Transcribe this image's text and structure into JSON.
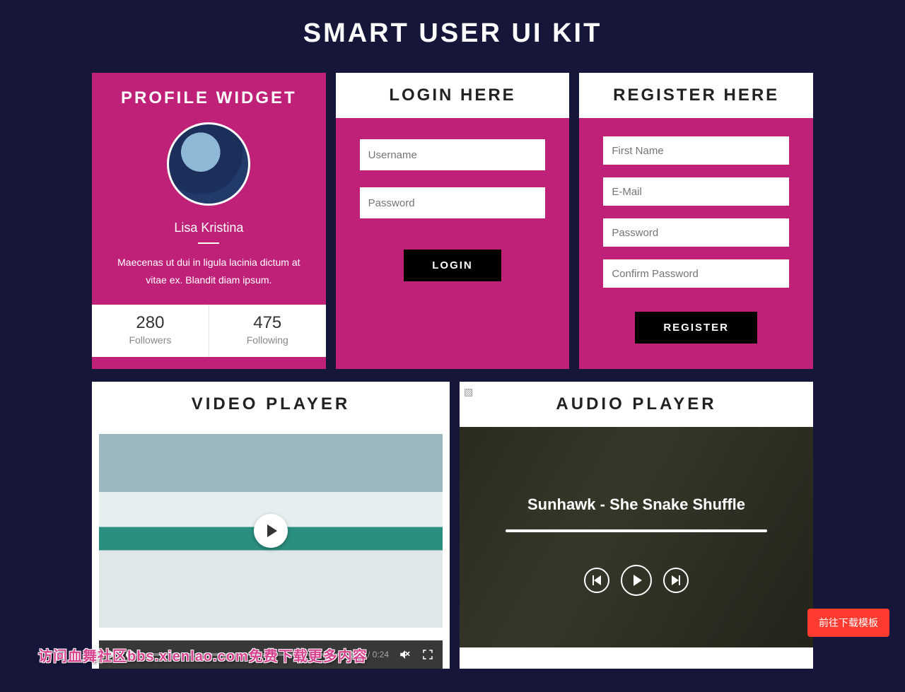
{
  "page": {
    "title": "SMART USER UI KIT"
  },
  "profile": {
    "header": "PROFILE WIDGET",
    "name": "Lisa Kristina",
    "desc": "Maecenas ut dui in ligula lacinia dictum at vitae ex. Blandit diam ipsum.",
    "followers_count": "280",
    "followers_label": "Followers",
    "following_count": "475",
    "following_label": "Following"
  },
  "login": {
    "header": "LOGIN HERE",
    "username_ph": "Username",
    "password_ph": "Password",
    "submit": "LOGIN"
  },
  "register": {
    "header": "REGISTER HERE",
    "firstname_ph": "First Name",
    "email_ph": "E-Mail",
    "password_ph": "Password",
    "confirm_ph": "Confirm Password",
    "submit": "REGISTER"
  },
  "video": {
    "header": "VIDEO PLAYER",
    "current_time": "0:00",
    "duration": "0:24"
  },
  "audio": {
    "header": "AUDIO PLAYER",
    "track": "Sunhawk - She Snake Shuffle"
  },
  "float_button": "前往下载模板",
  "watermark": "访问血舞社区bbs.xienlao.com免费下载更多内容"
}
